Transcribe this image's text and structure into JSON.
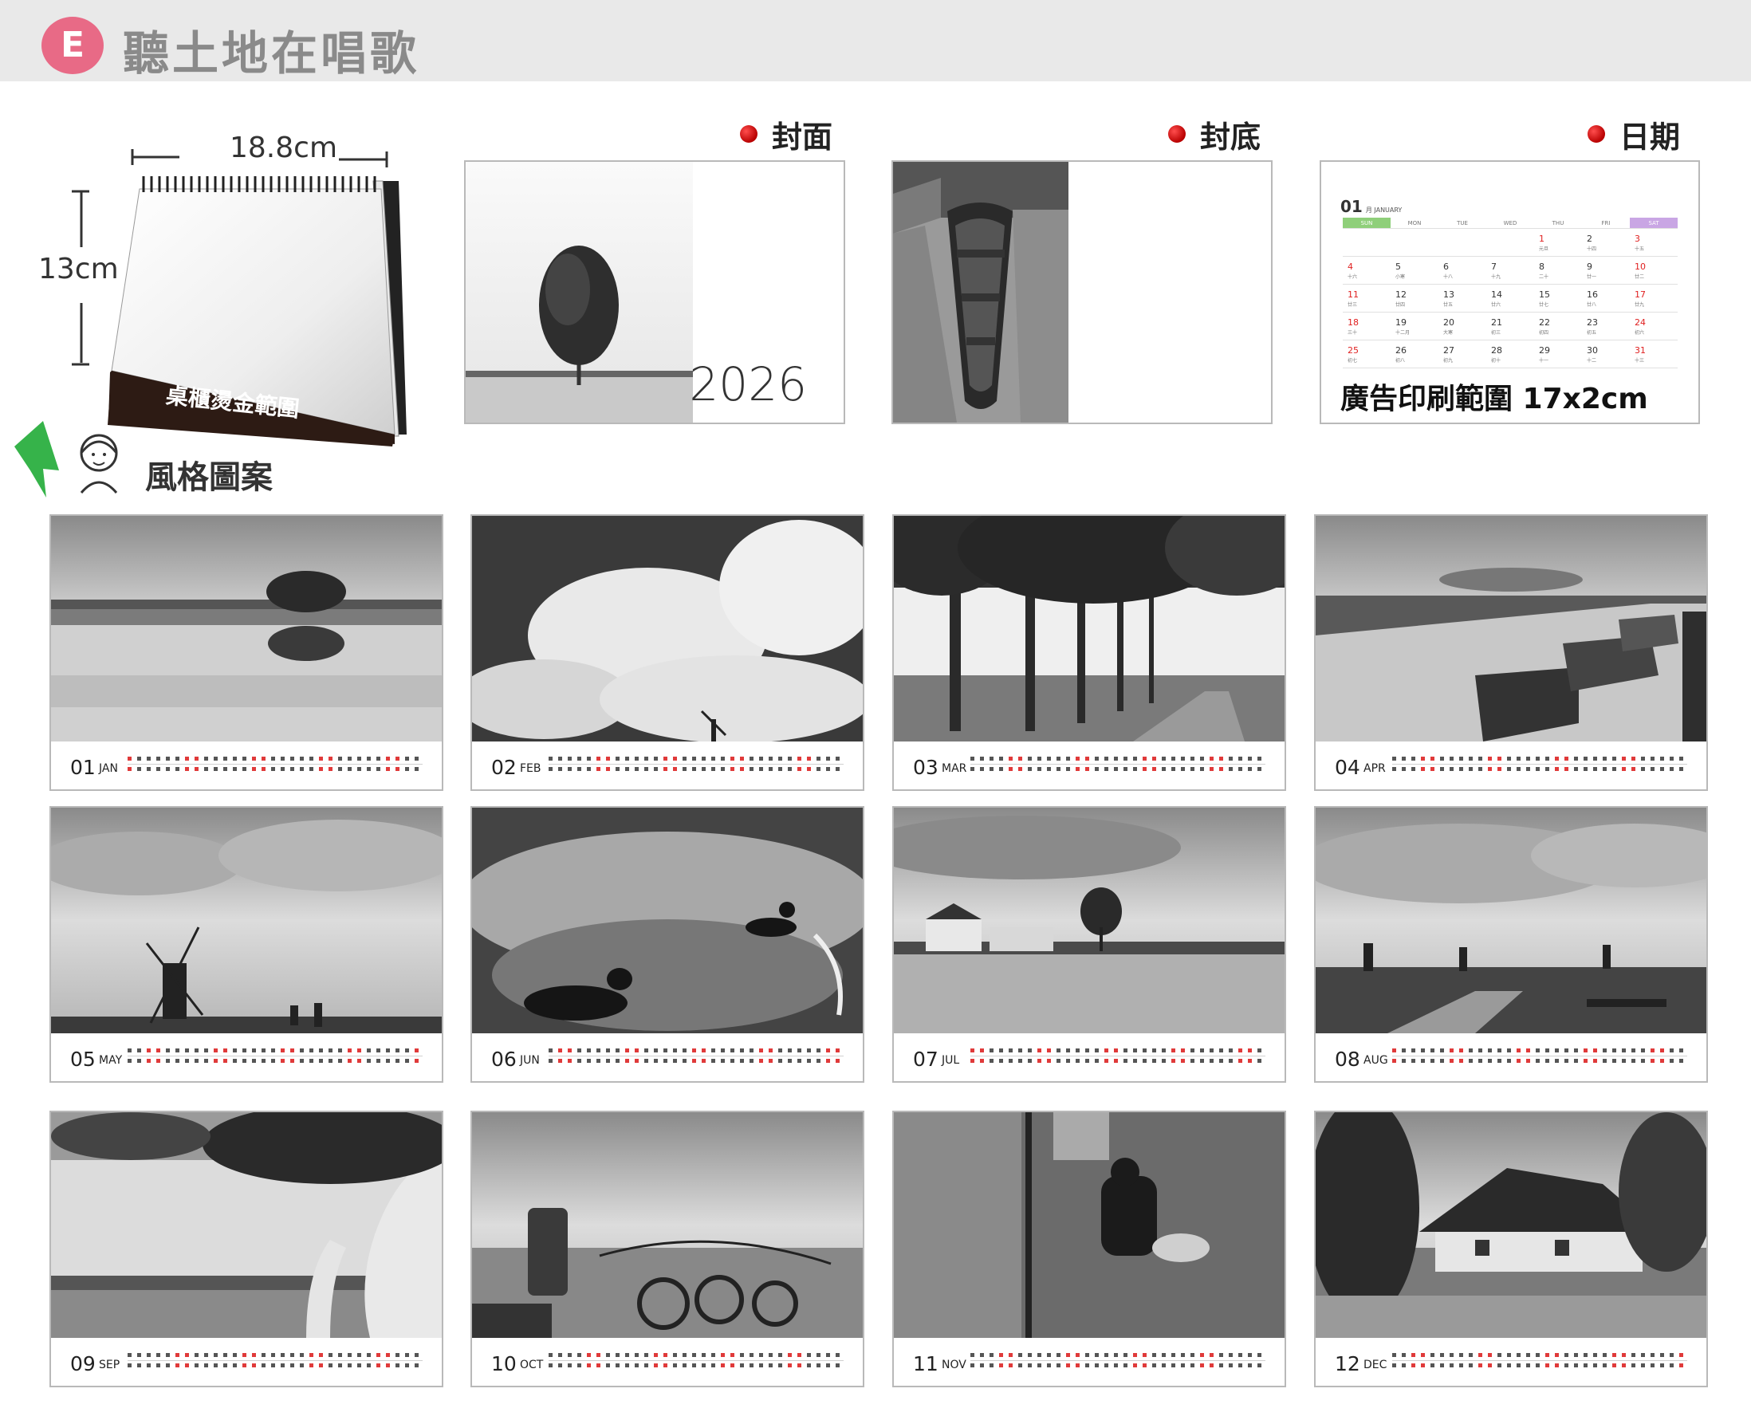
{
  "header": {
    "badge_letter": "E",
    "title": "聽土地在唱歌",
    "badge_color": "#e86a86"
  },
  "product": {
    "width_label": "18.8cm",
    "height_label": "13cm",
    "foil_label": "桌櫃燙金範圍"
  },
  "style": {
    "label": "風格圖案"
  },
  "sections": {
    "cover": "封面",
    "back": "封底",
    "dates": "日期"
  },
  "cover": {
    "year": "2026"
  },
  "date_panel": {
    "month_num": "01",
    "month_name": "月 JANUARY",
    "weekdays": [
      "SUN",
      "MON",
      "TUE",
      "WED",
      "THU",
      "FRI",
      "SAT"
    ],
    "weeks": [
      [
        {
          "d": "",
          "l": ""
        },
        {
          "d": "",
          "l": ""
        },
        {
          "d": "",
          "l": ""
        },
        {
          "d": "",
          "l": ""
        },
        {
          "d": "1",
          "l": "元旦"
        },
        {
          "d": "2",
          "l": "十四"
        },
        {
          "d": "3",
          "l": "十五"
        }
      ],
      [
        {
          "d": "4",
          "l": "十六"
        },
        {
          "d": "5",
          "l": "小寒"
        },
        {
          "d": "6",
          "l": "十八"
        },
        {
          "d": "7",
          "l": "十九"
        },
        {
          "d": "8",
          "l": "二十"
        },
        {
          "d": "9",
          "l": "廿一"
        },
        {
          "d": "10",
          "l": "廿二"
        }
      ],
      [
        {
          "d": "11",
          "l": "廿三"
        },
        {
          "d": "12",
          "l": "廿四"
        },
        {
          "d": "13",
          "l": "廿五"
        },
        {
          "d": "14",
          "l": "廿六"
        },
        {
          "d": "15",
          "l": "廿七"
        },
        {
          "d": "16",
          "l": "廿八"
        },
        {
          "d": "17",
          "l": "廿九"
        }
      ],
      [
        {
          "d": "18",
          "l": "三十"
        },
        {
          "d": "19",
          "l": "十二月"
        },
        {
          "d": "20",
          "l": "大寒"
        },
        {
          "d": "21",
          "l": "初三"
        },
        {
          "d": "22",
          "l": "初四"
        },
        {
          "d": "23",
          "l": "初五"
        },
        {
          "d": "24",
          "l": "初六"
        }
      ],
      [
        {
          "d": "25",
          "l": "初七"
        },
        {
          "d": "26",
          "l": "初八"
        },
        {
          "d": "27",
          "l": "初九"
        },
        {
          "d": "28",
          "l": "初十"
        },
        {
          "d": "29",
          "l": "十一"
        },
        {
          "d": "30",
          "l": "十二"
        },
        {
          "d": "31",
          "l": "十三"
        }
      ]
    ],
    "print_note": "廣告印刷範圍 17x2cm"
  },
  "months": [
    {
      "num": "01",
      "abbr": "JAN",
      "scene": "tree-reflection"
    },
    {
      "num": "02",
      "abbr": "FEB",
      "scene": "clouds-windmill"
    },
    {
      "num": "03",
      "abbr": "MAR",
      "scene": "tree-lane"
    },
    {
      "num": "04",
      "abbr": "APR",
      "scene": "boats-canal"
    },
    {
      "num": "05",
      "abbr": "MAY",
      "scene": "windmill-field"
    },
    {
      "num": "06",
      "abbr": "JUN",
      "scene": "ducks"
    },
    {
      "num": "07",
      "abbr": "JUL",
      "scene": "farm-canal"
    },
    {
      "num": "08",
      "abbr": "AUG",
      "scene": "windmills-path"
    },
    {
      "num": "09",
      "abbr": "SEP",
      "scene": "birch-tree"
    },
    {
      "num": "10",
      "abbr": "OCT",
      "scene": "rake-machine"
    },
    {
      "num": "11",
      "abbr": "NOV",
      "scene": "woman-dock"
    },
    {
      "num": "12",
      "abbr": "DEC",
      "scene": "thatched-house"
    }
  ]
}
